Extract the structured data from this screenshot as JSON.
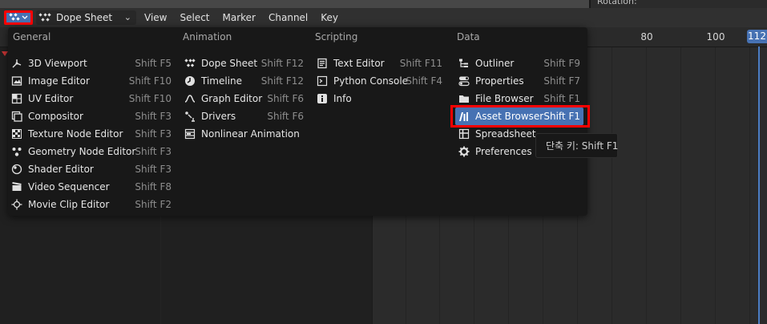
{
  "properties": {
    "rotation_label": "Rotation:"
  },
  "header": {
    "editor_type": "Dope Sheet",
    "menus": [
      "View",
      "Select",
      "Marker",
      "Channel",
      "Key"
    ]
  },
  "ruler": {
    "ticks": [
      "80",
      "100"
    ],
    "current_frame": "112"
  },
  "popup": {
    "columns": [
      {
        "title": "General",
        "items": [
          {
            "label": "3D Viewport",
            "shortcut": "Shift F5",
            "icon": "3d-viewport-icon"
          },
          {
            "label": "Image Editor",
            "shortcut": "Shift F10",
            "icon": "image-editor-icon"
          },
          {
            "label": "UV Editor",
            "shortcut": "Shift F10",
            "icon": "uv-editor-icon"
          },
          {
            "label": "Compositor",
            "shortcut": "Shift F3",
            "icon": "compositor-icon"
          },
          {
            "label": "Texture Node Editor",
            "shortcut": "Shift F3",
            "icon": "texture-node-icon"
          },
          {
            "label": "Geometry Node Editor",
            "shortcut": "Shift F3",
            "icon": "geometry-node-icon"
          },
          {
            "label": "Shader Editor",
            "shortcut": "Shift F3",
            "icon": "shader-editor-icon"
          },
          {
            "label": "Video Sequencer",
            "shortcut": "Shift F8",
            "icon": "video-sequencer-icon"
          },
          {
            "label": "Movie Clip Editor",
            "shortcut": "Shift F2",
            "icon": "movie-clip-icon"
          }
        ]
      },
      {
        "title": "Animation",
        "items": [
          {
            "label": "Dope Sheet",
            "shortcut": "Shift F12",
            "icon": "dope-sheet-icon"
          },
          {
            "label": "Timeline",
            "shortcut": "Shift F12",
            "icon": "timeline-icon"
          },
          {
            "label": "Graph Editor",
            "shortcut": "Shift F6",
            "icon": "graph-editor-icon"
          },
          {
            "label": "Drivers",
            "shortcut": "Shift F6",
            "icon": "drivers-icon"
          },
          {
            "label": "Nonlinear Animation",
            "shortcut": "",
            "icon": "nla-icon"
          }
        ]
      },
      {
        "title": "Scripting",
        "items": [
          {
            "label": "Text Editor",
            "shortcut": "Shift F11",
            "icon": "text-editor-icon"
          },
          {
            "label": "Python Console",
            "shortcut": "Shift F4",
            "icon": "python-console-icon"
          },
          {
            "label": "Info",
            "shortcut": "",
            "icon": "info-icon"
          }
        ]
      },
      {
        "title": "Data",
        "items": [
          {
            "label": "Outliner",
            "shortcut": "Shift F9",
            "icon": "outliner-icon"
          },
          {
            "label": "Properties",
            "shortcut": "Shift F7",
            "icon": "properties-icon"
          },
          {
            "label": "File Browser",
            "shortcut": "Shift F1",
            "icon": "file-browser-icon"
          },
          {
            "label": "Asset Browser",
            "shortcut": "Shift F1",
            "icon": "asset-browser-icon",
            "active": true
          },
          {
            "label": "Spreadsheet",
            "shortcut": "",
            "icon": "spreadsheet-icon"
          },
          {
            "label": "Preferences",
            "shortcut": "",
            "icon": "preferences-icon"
          }
        ]
      }
    ]
  },
  "tooltip": {
    "text": "단축 키: Shift F1"
  },
  "colors": {
    "accent": "#4772b3",
    "highlight": "#ff0000",
    "menu_bg": "#181818"
  }
}
